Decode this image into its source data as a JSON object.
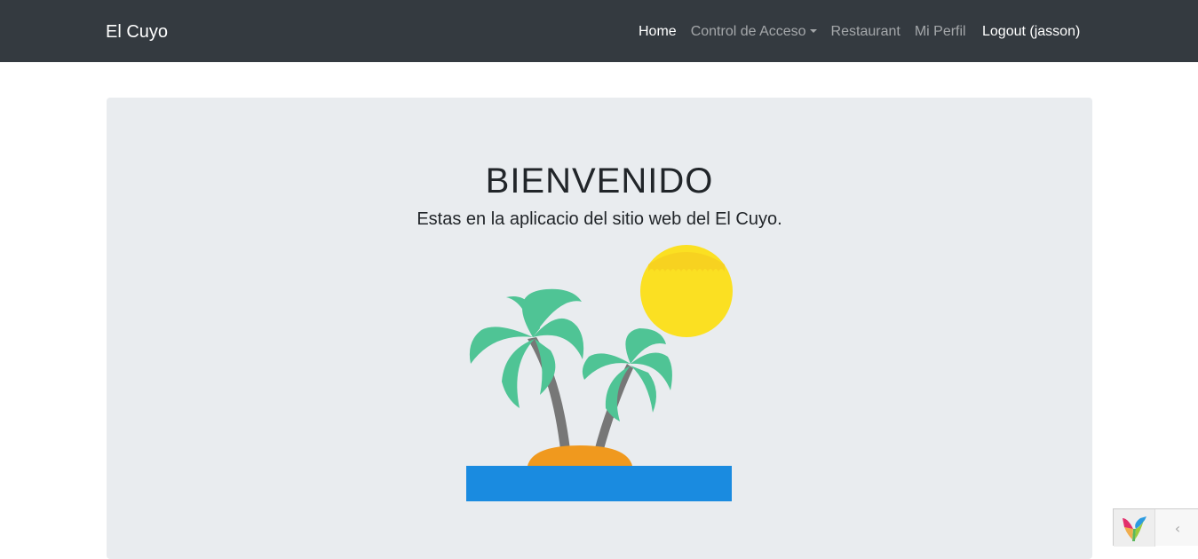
{
  "navbar": {
    "brand": "El Cuyo",
    "items": [
      {
        "label": "Home",
        "active": true
      },
      {
        "label": "Control de Acceso",
        "dropdown": true
      },
      {
        "label": "Restaurant"
      },
      {
        "label": "Mi Perfil"
      }
    ],
    "logout_label": "Logout (jasson)"
  },
  "main": {
    "title": "BIENVENIDO",
    "subtitle": "Estas en la aplicacio del sitio web del El Cuyo.",
    "illustration": "palm-island-sun-illustration"
  },
  "debug_toolbar": {
    "logo": "yii-logo-icon",
    "toggle_icon": "chevron-left-icon",
    "toggle_glyph": "‹"
  },
  "colors": {
    "navbar_bg": "#343a40",
    "jumbotron_bg": "#e9ecef",
    "palm_leaves": "#4fc495",
    "trunk": "#777777",
    "sand": "#f0991e",
    "water": "#1a8be0",
    "sun": "#fbe022"
  }
}
